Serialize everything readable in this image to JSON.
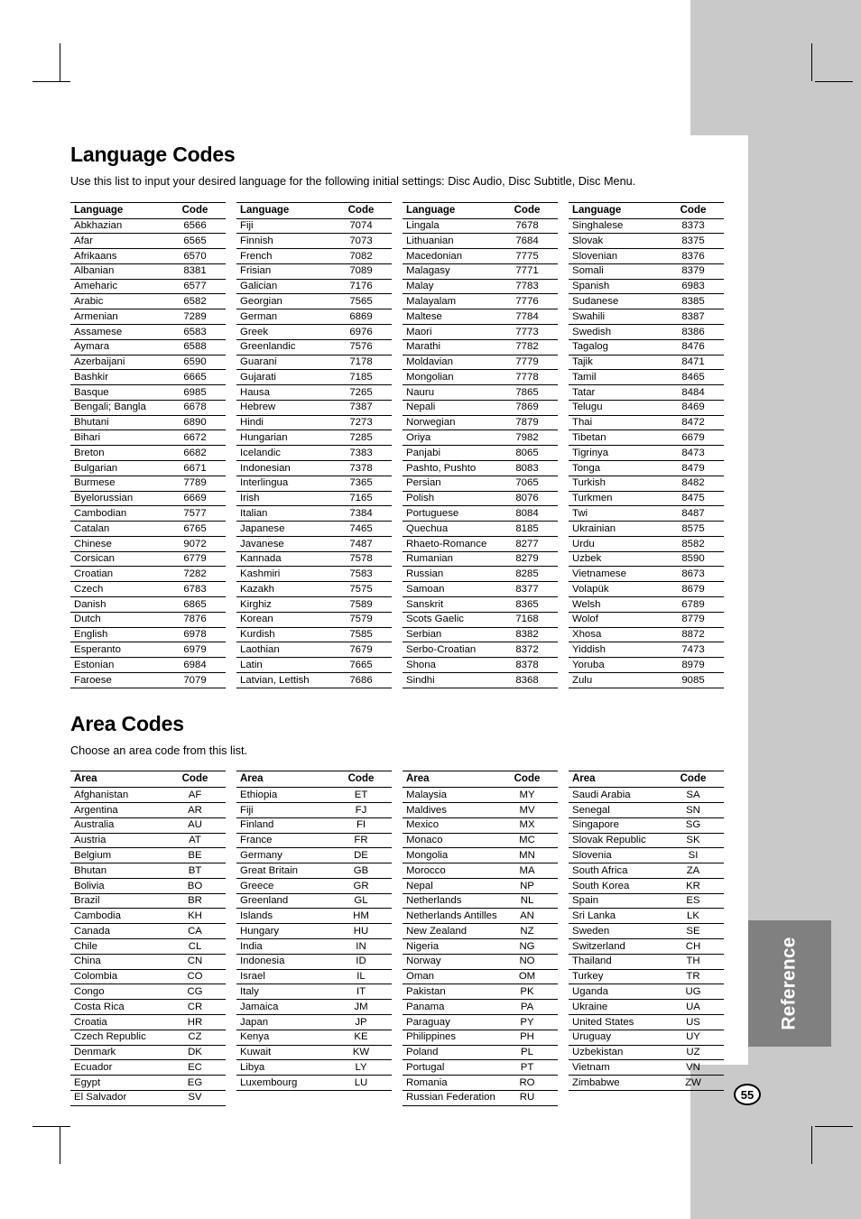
{
  "page": {
    "number": "55",
    "side_tab_label": "Reference"
  },
  "language_section": {
    "title": "Language Codes",
    "intro": "Use this list to input your desired language for the following initial settings: Disc Audio, Disc Subtitle, Disc Menu.",
    "headers": {
      "name": "Language",
      "code": "Code"
    },
    "columns": [
      [
        [
          "Abkhazian",
          "6566"
        ],
        [
          "Afar",
          "6565"
        ],
        [
          "Afrikaans",
          "6570"
        ],
        [
          "Albanian",
          "8381"
        ],
        [
          "Ameharic",
          "6577"
        ],
        [
          "Arabic",
          "6582"
        ],
        [
          "Armenian",
          "7289"
        ],
        [
          "Assamese",
          "6583"
        ],
        [
          "Aymara",
          "6588"
        ],
        [
          "Azerbaijani",
          "6590"
        ],
        [
          "Bashkir",
          "6665"
        ],
        [
          "Basque",
          "6985"
        ],
        [
          "Bengali; Bangla",
          "6678"
        ],
        [
          "Bhutani",
          "6890"
        ],
        [
          "Bihari",
          "6672"
        ],
        [
          "Breton",
          "6682"
        ],
        [
          "Bulgarian",
          "6671"
        ],
        [
          "Burmese",
          "7789"
        ],
        [
          "Byelorussian",
          "6669"
        ],
        [
          "Cambodian",
          "7577"
        ],
        [
          "Catalan",
          "6765"
        ],
        [
          "Chinese",
          "9072"
        ],
        [
          "Corsican",
          "6779"
        ],
        [
          "Croatian",
          "7282"
        ],
        [
          "Czech",
          "6783"
        ],
        [
          "Danish",
          "6865"
        ],
        [
          "Dutch",
          "7876"
        ],
        [
          "English",
          "6978"
        ],
        [
          "Esperanto",
          "6979"
        ],
        [
          "Estonian",
          "6984"
        ],
        [
          "Faroese",
          "7079"
        ]
      ],
      [
        [
          "Fiji",
          "7074"
        ],
        [
          "Finnish",
          "7073"
        ],
        [
          "French",
          "7082"
        ],
        [
          "Frisian",
          "7089"
        ],
        [
          "Galician",
          "7176"
        ],
        [
          "Georgian",
          "7565"
        ],
        [
          "German",
          "6869"
        ],
        [
          "Greek",
          "6976"
        ],
        [
          "Greenlandic",
          "7576"
        ],
        [
          "Guarani",
          "7178"
        ],
        [
          "Gujarati",
          "7185"
        ],
        [
          "Hausa",
          "7265"
        ],
        [
          "Hebrew",
          "7387"
        ],
        [
          "Hindi",
          "7273"
        ],
        [
          "Hungarian",
          "7285"
        ],
        [
          "Icelandic",
          "7383"
        ],
        [
          "Indonesian",
          "7378"
        ],
        [
          "Interlingua",
          "7365"
        ],
        [
          "Irish",
          "7165"
        ],
        [
          "Italian",
          "7384"
        ],
        [
          "Japanese",
          "7465"
        ],
        [
          "Javanese",
          "7487"
        ],
        [
          "Kannada",
          "7578"
        ],
        [
          "Kashmiri",
          "7583"
        ],
        [
          "Kazakh",
          "7575"
        ],
        [
          "Kirghiz",
          "7589"
        ],
        [
          "Korean",
          "7579"
        ],
        [
          "Kurdish",
          "7585"
        ],
        [
          "Laothian",
          "7679"
        ],
        [
          "Latin",
          "7665"
        ],
        [
          "Latvian, Lettish",
          "7686"
        ]
      ],
      [
        [
          "Lingala",
          "7678"
        ],
        [
          "Lithuanian",
          "7684"
        ],
        [
          "Macedonian",
          "7775"
        ],
        [
          "Malagasy",
          "7771"
        ],
        [
          "Malay",
          "7783"
        ],
        [
          "Malayalam",
          "7776"
        ],
        [
          "Maltese",
          "7784"
        ],
        [
          "Maori",
          "7773"
        ],
        [
          "Marathi",
          "7782"
        ],
        [
          "Moldavian",
          "7779"
        ],
        [
          "Mongolian",
          "7778"
        ],
        [
          "Nauru",
          "7865"
        ],
        [
          "Nepali",
          "7869"
        ],
        [
          "Norwegian",
          "7879"
        ],
        [
          "Oriya",
          "7982"
        ],
        [
          "Panjabi",
          "8065"
        ],
        [
          "Pashto, Pushto",
          "8083"
        ],
        [
          "Persian",
          "7065"
        ],
        [
          "Polish",
          "8076"
        ],
        [
          "Portuguese",
          "8084"
        ],
        [
          "Quechua",
          "8185"
        ],
        [
          "Rhaeto-Romance",
          "8277"
        ],
        [
          "Rumanian",
          "8279"
        ],
        [
          "Russian",
          "8285"
        ],
        [
          "Samoan",
          "8377"
        ],
        [
          "Sanskrit",
          "8365"
        ],
        [
          "Scots Gaelic",
          "7168"
        ],
        [
          "Serbian",
          "8382"
        ],
        [
          "Serbo-Croatian",
          "8372"
        ],
        [
          "Shona",
          "8378"
        ],
        [
          "Sindhi",
          "8368"
        ]
      ],
      [
        [
          "Singhalese",
          "8373"
        ],
        [
          "Slovak",
          "8375"
        ],
        [
          "Slovenian",
          "8376"
        ],
        [
          "Somali",
          "8379"
        ],
        [
          "Spanish",
          "6983"
        ],
        [
          "Sudanese",
          "8385"
        ],
        [
          "Swahili",
          "8387"
        ],
        [
          "Swedish",
          "8386"
        ],
        [
          "Tagalog",
          "8476"
        ],
        [
          "Tajik",
          "8471"
        ],
        [
          "Tamil",
          "8465"
        ],
        [
          "Tatar",
          "8484"
        ],
        [
          "Telugu",
          "8469"
        ],
        [
          "Thai",
          "8472"
        ],
        [
          "Tibetan",
          "6679"
        ],
        [
          "Tigrinya",
          "8473"
        ],
        [
          "Tonga",
          "8479"
        ],
        [
          "Turkish",
          "8482"
        ],
        [
          "Turkmen",
          "8475"
        ],
        [
          "Twi",
          "8487"
        ],
        [
          "Ukrainian",
          "8575"
        ],
        [
          "Urdu",
          "8582"
        ],
        [
          "Uzbek",
          "8590"
        ],
        [
          "Vietnamese",
          "8673"
        ],
        [
          "Volapük",
          "8679"
        ],
        [
          "Welsh",
          "6789"
        ],
        [
          "Wolof",
          "8779"
        ],
        [
          "Xhosa",
          "8872"
        ],
        [
          "Yiddish",
          "7473"
        ],
        [
          "Yoruba",
          "8979"
        ],
        [
          "Zulu",
          "9085"
        ]
      ]
    ]
  },
  "area_section": {
    "title": "Area Codes",
    "intro": "Choose an area code from this list.",
    "headers": {
      "name": "Area",
      "code": "Code"
    },
    "columns": [
      [
        [
          "Afghanistan",
          "AF"
        ],
        [
          "Argentina",
          "AR"
        ],
        [
          "Australia",
          "AU"
        ],
        [
          "Austria",
          "AT"
        ],
        [
          "Belgium",
          "BE"
        ],
        [
          "Bhutan",
          "BT"
        ],
        [
          "Bolivia",
          "BO"
        ],
        [
          "Brazil",
          "BR"
        ],
        [
          "Cambodia",
          "KH"
        ],
        [
          "Canada",
          "CA"
        ],
        [
          "Chile",
          "CL"
        ],
        [
          "China",
          "CN"
        ],
        [
          "Colombia",
          "CO"
        ],
        [
          "Congo",
          "CG"
        ],
        [
          "Costa Rica",
          "CR"
        ],
        [
          "Croatia",
          "HR"
        ],
        [
          "Czech Republic",
          "CZ"
        ],
        [
          "Denmark",
          "DK"
        ],
        [
          "Ecuador",
          "EC"
        ],
        [
          "Egypt",
          "EG"
        ],
        [
          "El Salvador",
          "SV"
        ]
      ],
      [
        [
          "Ethiopia",
          "ET"
        ],
        [
          "Fiji",
          "FJ"
        ],
        [
          "Finland",
          "FI"
        ],
        [
          "France",
          "FR"
        ],
        [
          "Germany",
          "DE"
        ],
        [
          "Great Britain",
          "GB"
        ],
        [
          "Greece",
          "GR"
        ],
        [
          "Greenland",
          "GL"
        ],
        [
          "Islands",
          "HM"
        ],
        [
          "Hungary",
          "HU"
        ],
        [
          "India",
          "IN"
        ],
        [
          "Indonesia",
          "ID"
        ],
        [
          "Israel",
          "IL"
        ],
        [
          "Italy",
          "IT"
        ],
        [
          "Jamaica",
          "JM"
        ],
        [
          "Japan",
          "JP"
        ],
        [
          "Kenya",
          "KE"
        ],
        [
          "Kuwait",
          "KW"
        ],
        [
          "Libya",
          "LY"
        ],
        [
          "Luxembourg",
          "LU"
        ]
      ],
      [
        [
          "Malaysia",
          "MY"
        ],
        [
          "Maldives",
          "MV"
        ],
        [
          "Mexico",
          "MX"
        ],
        [
          "Monaco",
          "MC"
        ],
        [
          "Mongolia",
          "MN"
        ],
        [
          "Morocco",
          "MA"
        ],
        [
          "Nepal",
          "NP"
        ],
        [
          "Netherlands",
          "NL"
        ],
        [
          "Netherlands Antilles",
          "AN"
        ],
        [
          "New Zealand",
          "NZ"
        ],
        [
          "Nigeria",
          "NG"
        ],
        [
          "Norway",
          "NO"
        ],
        [
          "Oman",
          "OM"
        ],
        [
          "Pakistan",
          "PK"
        ],
        [
          "Panama",
          "PA"
        ],
        [
          "Paraguay",
          "PY"
        ],
        [
          "Philippines",
          "PH"
        ],
        [
          "Poland",
          "PL"
        ],
        [
          "Portugal",
          "PT"
        ],
        [
          "Romania",
          "RO"
        ],
        [
          "Russian Federation",
          "RU"
        ]
      ],
      [
        [
          "Saudi Arabia",
          "SA"
        ],
        [
          "Senegal",
          "SN"
        ],
        [
          "Singapore",
          "SG"
        ],
        [
          "Slovak Republic",
          "SK"
        ],
        [
          "Slovenia",
          "SI"
        ],
        [
          "South Africa",
          "ZA"
        ],
        [
          "South Korea",
          "KR"
        ],
        [
          "Spain",
          "ES"
        ],
        [
          "Sri Lanka",
          "LK"
        ],
        [
          "Sweden",
          "SE"
        ],
        [
          "Switzerland",
          "CH"
        ],
        [
          "Thailand",
          "TH"
        ],
        [
          "Turkey",
          "TR"
        ],
        [
          "Uganda",
          "UG"
        ],
        [
          "Ukraine",
          "UA"
        ],
        [
          "United States",
          "US"
        ],
        [
          "Uruguay",
          "UY"
        ],
        [
          "Uzbekistan",
          "UZ"
        ],
        [
          "Vietnam",
          "VN"
        ],
        [
          "Zimbabwe",
          "ZW"
        ]
      ]
    ]
  }
}
